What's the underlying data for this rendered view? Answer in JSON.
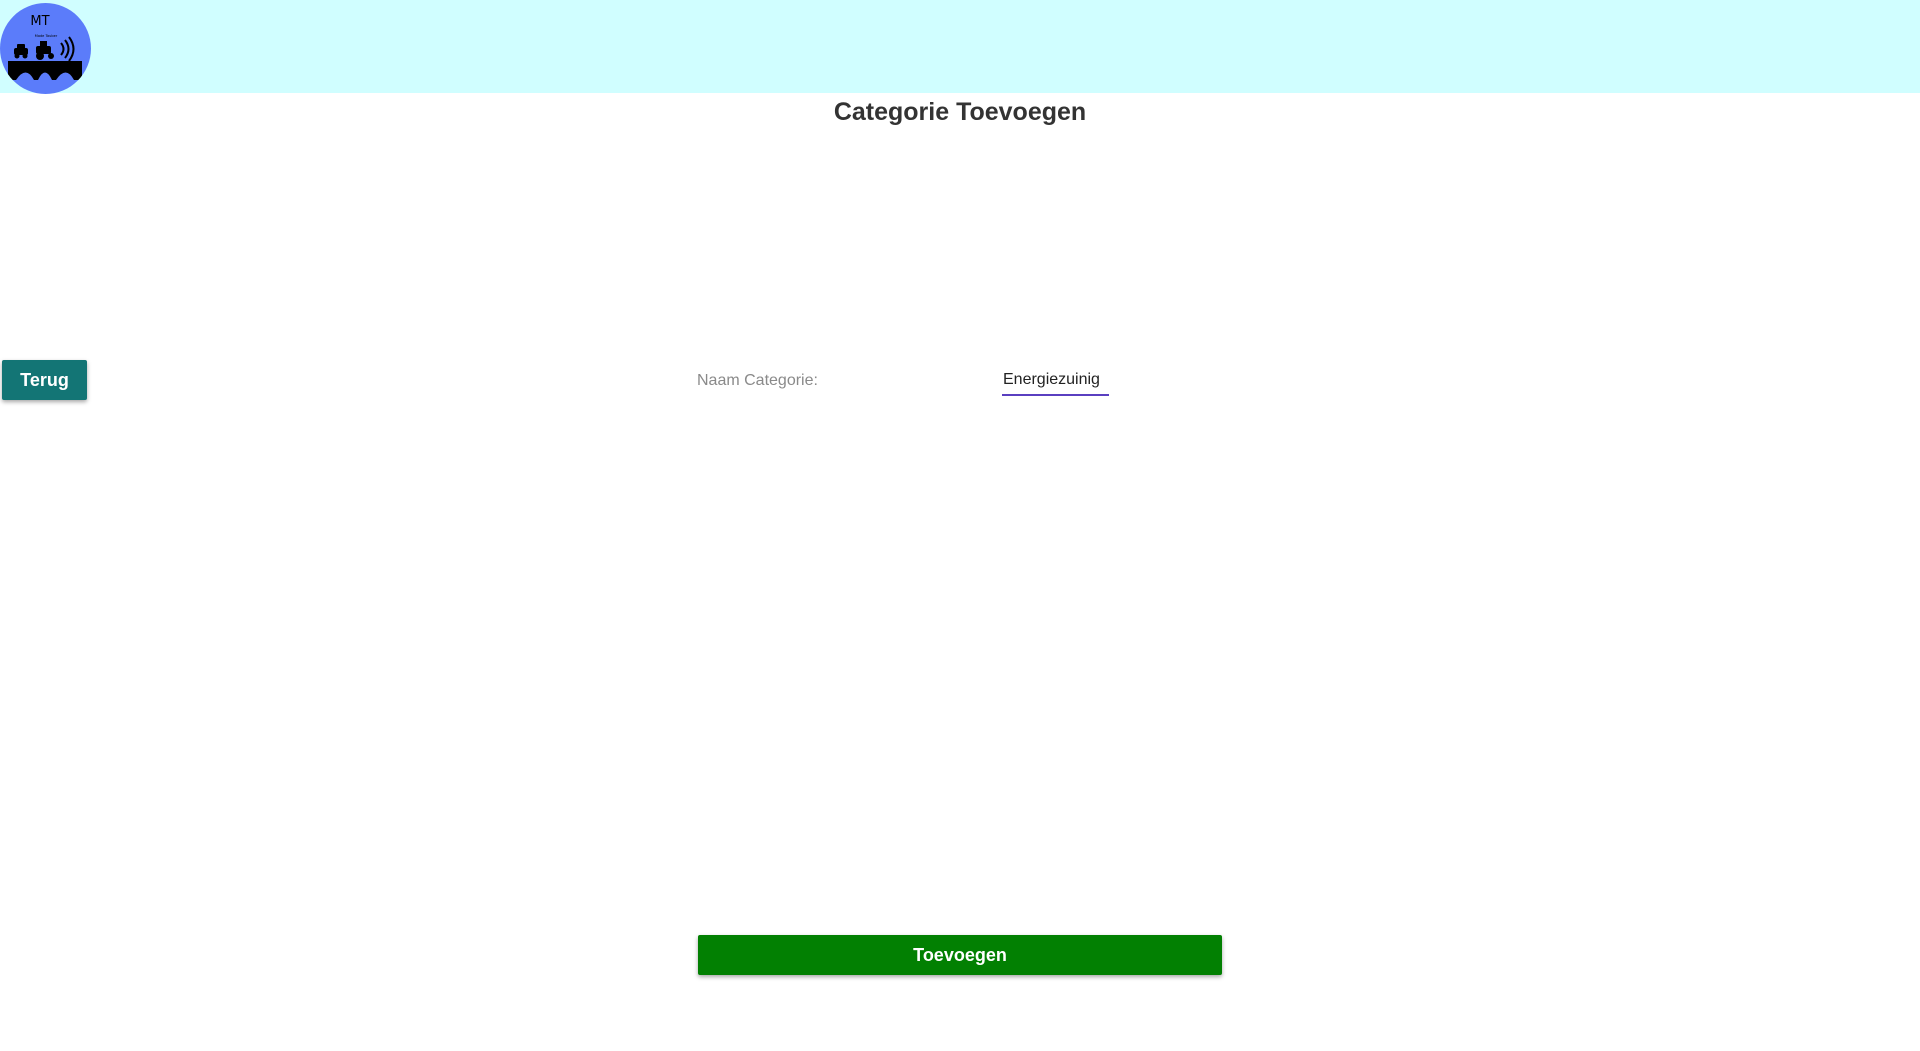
{
  "header": {
    "logo": {
      "icon": "mt-logo-icon",
      "text": "MT",
      "subtext": "Made Tauber",
      "background": "#5b7cfa"
    },
    "background": "#d0feff"
  },
  "page": {
    "title": "Categorie Toevoegen"
  },
  "actions": {
    "back_label": "Terug",
    "back_color": "#137575",
    "submit_label": "Toevoegen",
    "submit_color": "#028002"
  },
  "form": {
    "name_label": "Naam Categorie:",
    "name_value": "Energiezuinig"
  }
}
